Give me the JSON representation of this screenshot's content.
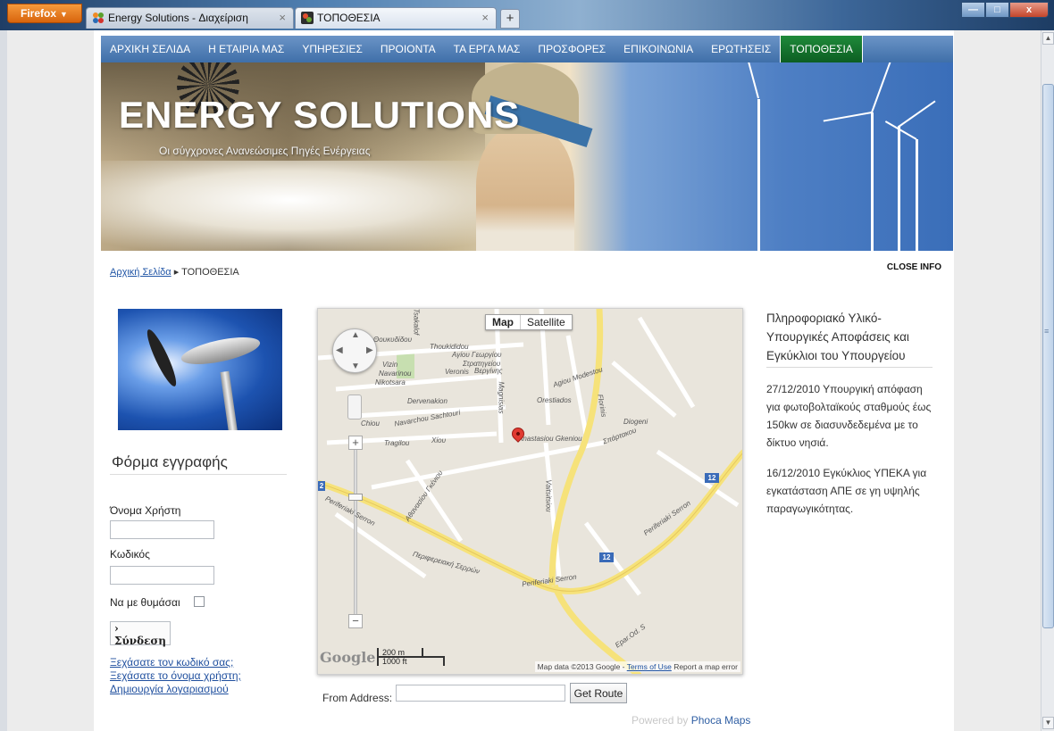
{
  "browser": {
    "menu_button": "Firefox",
    "tabs": [
      {
        "label": "Energy Solutions - Διαχείριση",
        "active": false
      },
      {
        "label": "ΤΟΠΟΘΕΣΙΑ",
        "active": true
      }
    ],
    "new_tab_symbol": "+",
    "window_buttons": [
      "—",
      "□",
      "x"
    ]
  },
  "nav": {
    "items": [
      {
        "label": "ΑΡΧΙΚΗ ΣΕΛΙΔΑ"
      },
      {
        "label": "Η ΕΤΑΙΡΙΑ ΜΑΣ"
      },
      {
        "label": "ΥΠΗΡΕΣΙΕΣ"
      },
      {
        "label": "ΠΡΟΙΟΝΤΑ"
      },
      {
        "label": "ΤΑ ΕΡΓΑ ΜΑΣ"
      },
      {
        "label": "ΠΡΟΣΦΟΡΕΣ"
      },
      {
        "label": "ΕΠΙΚΟΙΝΩΝΙΑ"
      },
      {
        "label": "ΕΡΩΤΗΣΕΙΣ"
      },
      {
        "label": "ΤΟΠΟΘΕΣΙΑ",
        "active": true
      }
    ]
  },
  "banner": {
    "title": "ENERGY SOLUTIONS",
    "subtitle": "Οι σύγχρονες Ανανεώσιμες Πηγές Ενέργειας"
  },
  "breadcrumb": {
    "home": "Αρχική Σελίδα",
    "separator": "▸",
    "current": "ΤΟΠΟΘΕΣΙΑ",
    "close_info": "CLOSE INFO"
  },
  "login": {
    "title": "Φόρμα εγγραφής",
    "username_label": "Όνομα Χρήστη",
    "password_label": "Κωδικός",
    "remember_label": "Να με θυμάσαι",
    "submit_label": "Σύνδεση",
    "forgot_password": "Ξεχάσατε τον κωδικό σας;",
    "forgot_username": "Ξεχάσατε το όνομα χρήστη;",
    "create_account": "Δημιουργία λογαριασμού"
  },
  "map": {
    "type_map": "Map",
    "type_satellite": "Satellite",
    "logo": "Google",
    "scale_metric": "200 m",
    "scale_imperial": "1000 ft",
    "attribution_data": "Map data ©2013 Google -",
    "attribution_terms": "Terms of Use",
    "attribution_report": "Report a map error",
    "streets": {
      "thoukididou_gr": "Θουκυδίδου",
      "thoukididou": "Thoukididou",
      "vizin": "Vizin",
      "navarinou": "Navarinou",
      "nikotsara": "Nikotsara",
      "dervenakion": "Dervenakion",
      "agiou_georgiou": "Αγίου Γεωργίου",
      "stratigeiou": "Στρατηγείου",
      "veronis": "Veronis",
      "verginis": "Βεργίνης",
      "agiou_modestou": "Agiou Modestou",
      "magnisias": "Magnisias",
      "orestiados": "Orestiados",
      "florinis": "Florinis",
      "navarchou": "Navarchou Sachtouri",
      "chiou": "Chiou",
      "tragilou": "Tragilou",
      "xiou": "Χίου",
      "gkeniou": "Anastasiou Gkeniou",
      "diogeni": "Diogeni",
      "spartakou": "Σπάρτακου",
      "athanasiou": "Αθανασίου Γκένιου",
      "vaitsitsiou": "Vaitsitsiou",
      "periferiaki_serron_1": "Periferiaki Serron",
      "periferiaki_serron_gr": "Περιφερειακή Σερρών",
      "periferiaki_serron_2": "Periferiaki Serron",
      "periferiaki_serron_3": "Periferiaki Serron",
      "epar_od": "Epar.Od. S",
      "tsakalof": "Tsakalof",
      "shield_12": "12",
      "shield_2": "2"
    }
  },
  "route": {
    "from_label": "From Address:",
    "button_label": "Get Route",
    "powered_prefix": "Powered by",
    "powered_brand": "Phoca Maps"
  },
  "info": {
    "title": "Πληροφοριακό Υλικό-Υπουργικές Αποφάσεις και Εγκύκλιοι του Υπουργείου",
    "items": [
      "27/12/2010 Υπουργική απόφαση για φωτοβολταϊκούς σταθμούς έως 150kw σε διασυνδεδεμένα με το δίκτυο νησιά.",
      "16/12/2010  Εγκύκλιος ΥΠΕΚΑ για εγκατάσταση ΑΠΕ σε γη υψηλής παραγωγικότητας."
    ]
  }
}
